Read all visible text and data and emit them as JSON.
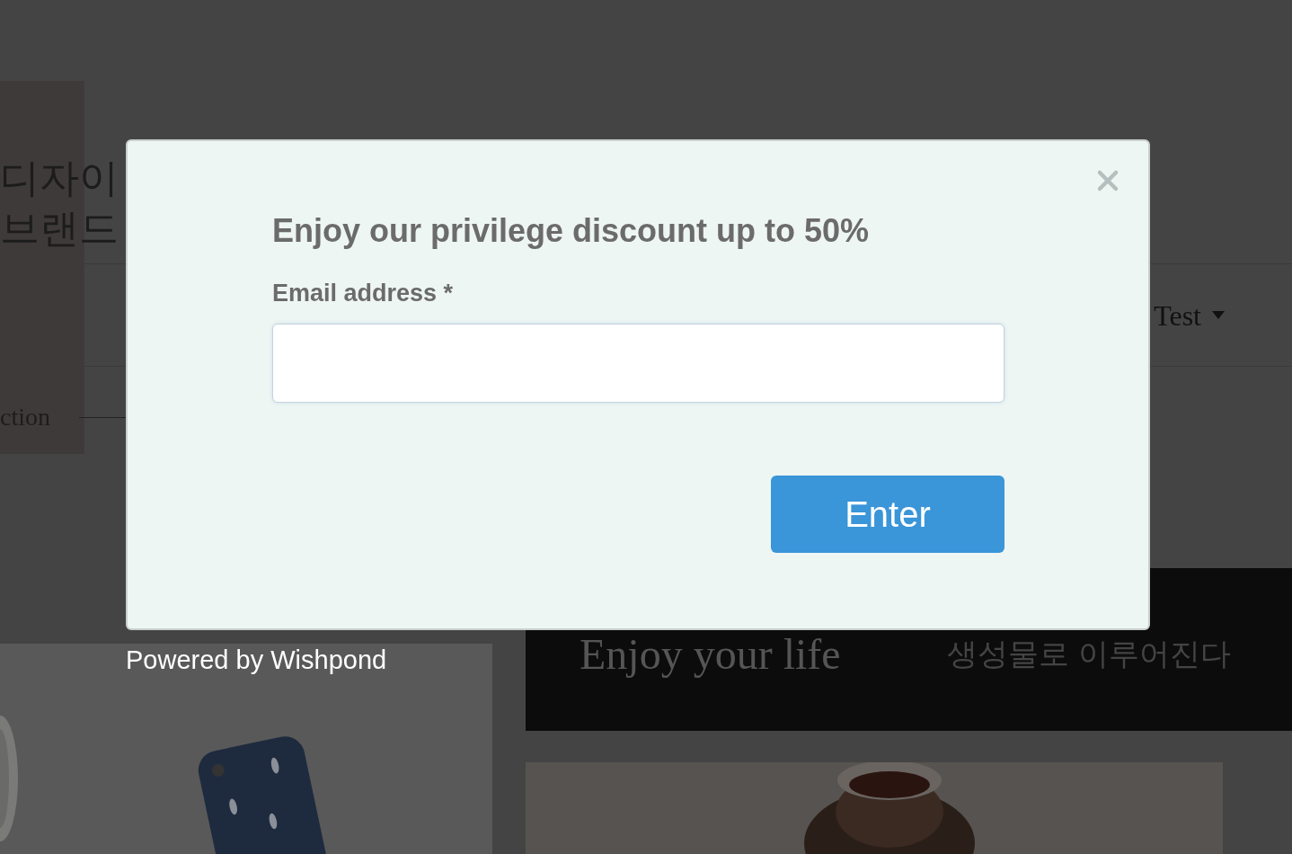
{
  "background_page": {
    "hero_panel": {
      "lines": [
        "디자이",
        "브랜드"
      ],
      "link_text": "ction"
    },
    "nav": {
      "menu_label": "Test"
    },
    "banner": {
      "heading": "Enjoy your life",
      "subheading": "생성물로 이루어진다"
    }
  },
  "popup": {
    "title": "Enjoy our privilege discount up to 50%",
    "email_label": "Email address *",
    "submit_button": "Enter"
  },
  "footer": "Powered by Wishpond"
}
